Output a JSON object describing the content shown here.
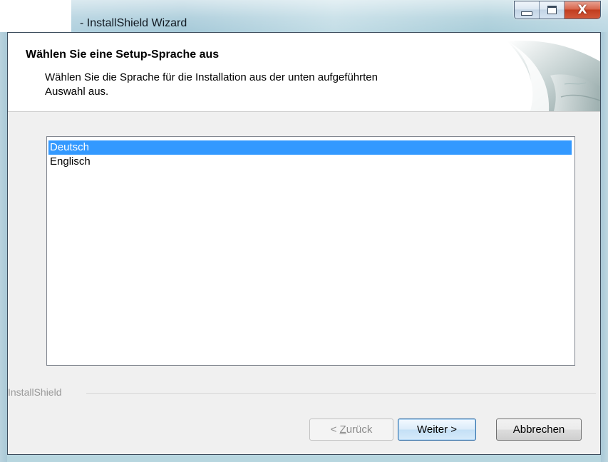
{
  "window": {
    "title": "- InstallShield Wizard",
    "close_glyph": "X"
  },
  "header": {
    "title": "Wählen Sie eine Setup-Sprache aus",
    "description": "Wählen Sie die Sprache für die Installation aus der unten aufgeführten Auswahl aus."
  },
  "languages": {
    "items": [
      {
        "label": "Deutsch",
        "selected": true
      },
      {
        "label": "Englisch",
        "selected": false
      }
    ],
    "selection_color": "#3399ff"
  },
  "footer": {
    "brand": "InstallShield"
  },
  "buttons": {
    "back_prefix": "< ",
    "back_mnemonic": "Z",
    "back_rest": "urück",
    "back_enabled": false,
    "next_label": "Weiter >",
    "cancel_label": "Abbrechen"
  },
  "icons": {
    "minimize": "minimize-icon",
    "maximize": "maximize-icon",
    "close": "close-icon",
    "header_graphic": "page-curl-graphic"
  }
}
